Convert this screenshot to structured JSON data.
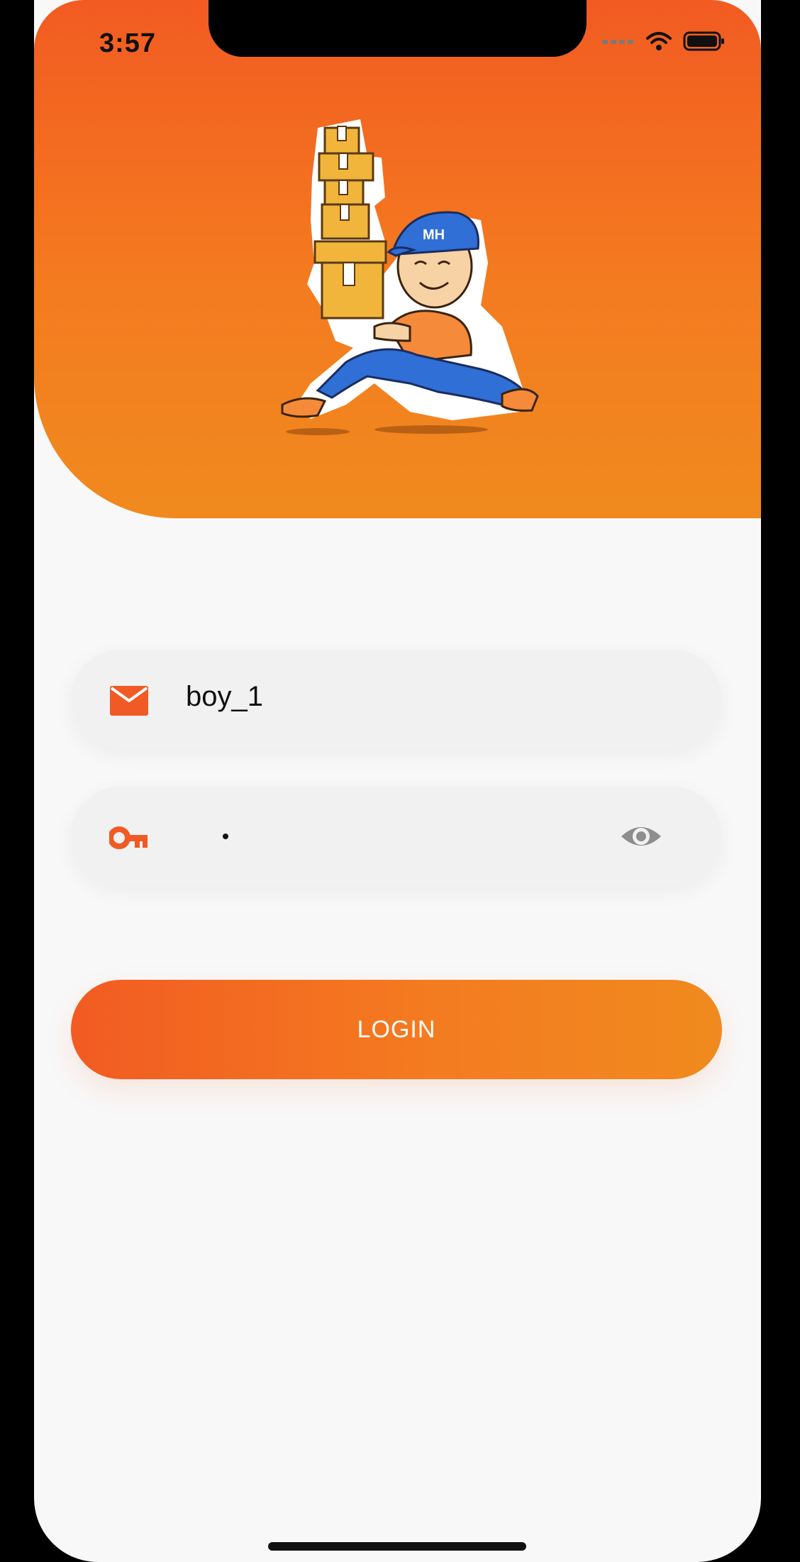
{
  "status_bar": {
    "time": "3:57"
  },
  "header": {
    "gradient_start": "#f25b22",
    "gradient_end": "#f08a1e",
    "illustration": "delivery-man-with-boxes",
    "cap_text": "MH"
  },
  "login_form": {
    "email": {
      "icon": "mail-icon",
      "value": "boy_1"
    },
    "password": {
      "icon": "key-icon",
      "masked_value": "•",
      "visibility_icon": "eye-icon"
    },
    "login_label": "LOGIN"
  },
  "colors": {
    "accent": "#f15a24",
    "field_bg": "#f1f1f1",
    "page_bg": "#f8f8f8",
    "icon_gray": "#8e8e8e"
  }
}
